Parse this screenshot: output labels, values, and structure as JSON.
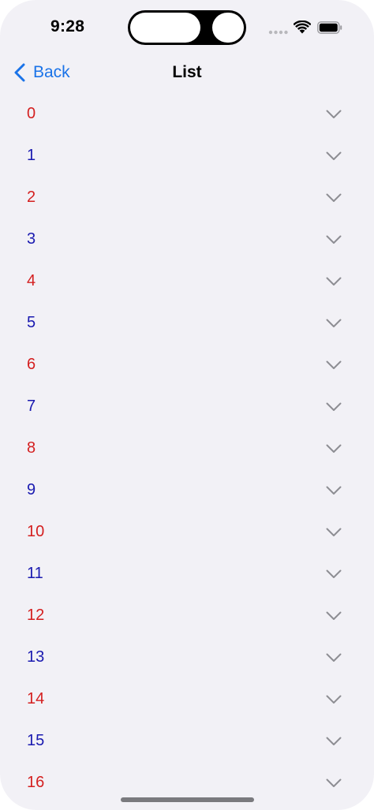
{
  "status_bar": {
    "time": "9:28"
  },
  "nav": {
    "back_label": "Back",
    "title": "List"
  },
  "colors": {
    "accent": "#1a73e8",
    "even_item": "#d42020",
    "odd_item": "#1a1ab0",
    "background": "#f2f1f6",
    "chevron": "#8e8e93"
  },
  "list": {
    "items": [
      {
        "label": "0",
        "color": "red"
      },
      {
        "label": "1",
        "color": "blue"
      },
      {
        "label": "2",
        "color": "red"
      },
      {
        "label": "3",
        "color": "blue"
      },
      {
        "label": "4",
        "color": "red"
      },
      {
        "label": "5",
        "color": "blue"
      },
      {
        "label": "6",
        "color": "red"
      },
      {
        "label": "7",
        "color": "blue"
      },
      {
        "label": "8",
        "color": "red"
      },
      {
        "label": "9",
        "color": "blue"
      },
      {
        "label": "10",
        "color": "red"
      },
      {
        "label": "11",
        "color": "blue"
      },
      {
        "label": "12",
        "color": "red"
      },
      {
        "label": "13",
        "color": "blue"
      },
      {
        "label": "14",
        "color": "red"
      },
      {
        "label": "15",
        "color": "blue"
      },
      {
        "label": "16",
        "color": "red"
      }
    ],
    "accessory_icon": "chevron-down-icon"
  }
}
